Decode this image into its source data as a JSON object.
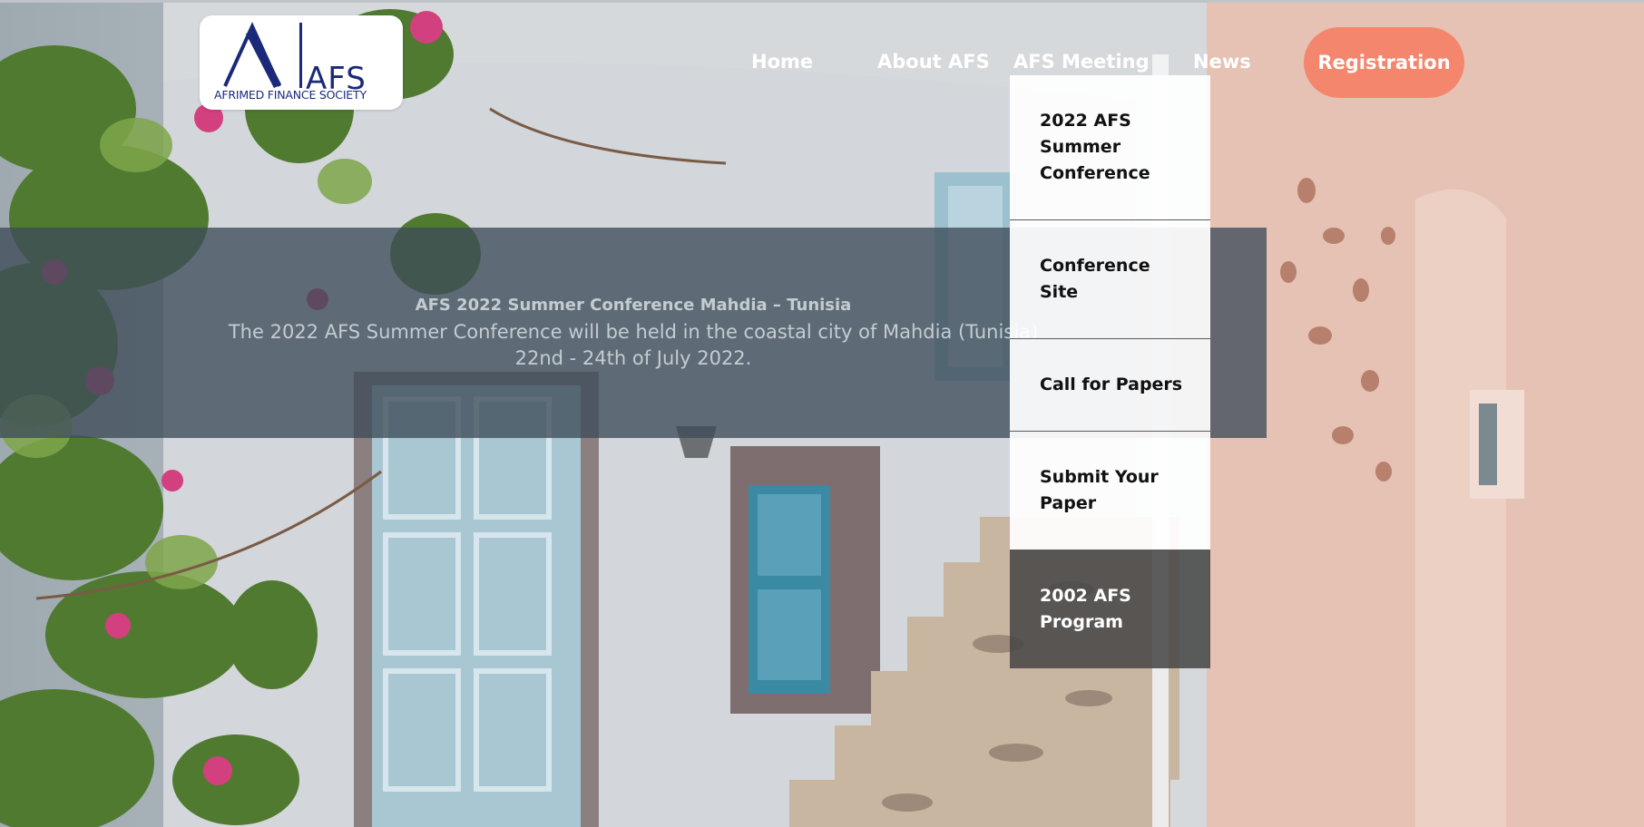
{
  "logo": {
    "abbr": "AFS",
    "full_name": "AFRIMED FINANCE SOCIETY"
  },
  "nav": {
    "home": "Home",
    "about": "About AFS",
    "meeting": "AFS Meeting",
    "news": "News",
    "registration": "Registration"
  },
  "dropdown": {
    "items": [
      "2022 AFS Summer Conference",
      "Conference Site",
      "Call for Papers",
      "Submit Your Paper",
      "2002 AFS Program"
    ],
    "active_index": 4
  },
  "banner": {
    "title": "AFS 2022 Summer Conference Mahdia – Tunisia",
    "line1": "The 2022 AFS Summer Conference will be held in the coastal city of Mahdia (Tunisia)",
    "line2": "22nd - 24th of July 2022."
  },
  "colors": {
    "registration_button": "#f4866e",
    "logo_text": "#1a2a78",
    "banner_overlay": "#3e4c58",
    "active_dropdown": "#484848"
  }
}
